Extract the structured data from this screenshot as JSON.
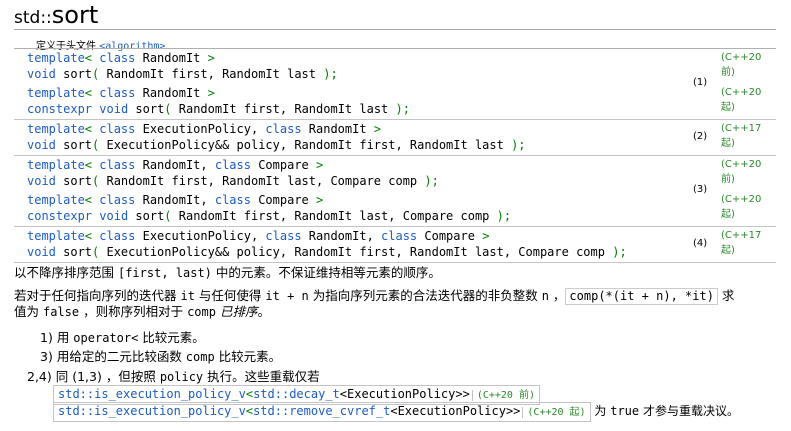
{
  "title": {
    "namespace": "std::",
    "name": "sort"
  },
  "header": {
    "label": "定义于头文件 ",
    "file": "<algorithm>"
  },
  "decls": [
    {
      "num": "(1)",
      "rows": [
        {
          "std": "(C++20 前)",
          "parts": [
            [
              "kw",
              "template"
            ],
            [
              "pn",
              "< "
            ],
            [
              "kw",
              "class"
            ],
            [
              "",
              " RandomIt "
            ],
            [
              "pn",
              ">"
            ],
            [
              "nl",
              ""
            ],
            [
              "kw",
              "void"
            ],
            [
              "",
              " sort"
            ],
            [
              "pn",
              "( "
            ],
            [
              "",
              "RandomIt first, RandomIt last "
            ],
            [
              "pn",
              ");"
            ]
          ]
        },
        {
          "std": "(C++20 起)",
          "parts": [
            [
              "kw",
              "template"
            ],
            [
              "pn",
              "< "
            ],
            [
              "kw",
              "class"
            ],
            [
              "",
              " RandomIt "
            ],
            [
              "pn",
              ">"
            ],
            [
              "nl",
              ""
            ],
            [
              "kw",
              "constexpr"
            ],
            [
              "",
              " "
            ],
            [
              "kw",
              "void"
            ],
            [
              "",
              " sort"
            ],
            [
              "pn",
              "( "
            ],
            [
              "",
              "RandomIt first, RandomIt last "
            ],
            [
              "pn",
              ");"
            ]
          ]
        }
      ]
    },
    {
      "num": "(2)",
      "rows": [
        {
          "std": "(C++17 起)",
          "parts": [
            [
              "kw",
              "template"
            ],
            [
              "pn",
              "< "
            ],
            [
              "kw",
              "class"
            ],
            [
              "",
              " ExecutionPolicy, "
            ],
            [
              "kw",
              "class"
            ],
            [
              "",
              " RandomIt "
            ],
            [
              "pn",
              ">"
            ],
            [
              "nl",
              ""
            ],
            [
              "kw",
              "void"
            ],
            [
              "",
              " sort"
            ],
            [
              "pn",
              "( "
            ],
            [
              "",
              "ExecutionPolicy&& policy, RandomIt first, RandomIt last "
            ],
            [
              "pn",
              ");"
            ]
          ]
        }
      ]
    },
    {
      "num": "(3)",
      "rows": [
        {
          "std": "(C++20 前)",
          "parts": [
            [
              "kw",
              "template"
            ],
            [
              "pn",
              "< "
            ],
            [
              "kw",
              "class"
            ],
            [
              "",
              " RandomIt, "
            ],
            [
              "kw",
              "class"
            ],
            [
              "",
              " Compare "
            ],
            [
              "pn",
              ">"
            ],
            [
              "nl",
              ""
            ],
            [
              "kw",
              "void"
            ],
            [
              "",
              " sort"
            ],
            [
              "pn",
              "( "
            ],
            [
              "",
              "RandomIt first, RandomIt last, Compare comp "
            ],
            [
              "pn",
              ");"
            ]
          ]
        },
        {
          "std": "(C++20 起)",
          "parts": [
            [
              "kw",
              "template"
            ],
            [
              "pn",
              "< "
            ],
            [
              "kw",
              "class"
            ],
            [
              "",
              " RandomIt, "
            ],
            [
              "kw",
              "class"
            ],
            [
              "",
              " Compare "
            ],
            [
              "pn",
              ">"
            ],
            [
              "nl",
              ""
            ],
            [
              "kw",
              "constexpr"
            ],
            [
              "",
              " "
            ],
            [
              "kw",
              "void"
            ],
            [
              "",
              " sort"
            ],
            [
              "pn",
              "( "
            ],
            [
              "",
              "RandomIt first, RandomIt last, Compare comp "
            ],
            [
              "pn",
              ");"
            ]
          ]
        }
      ]
    },
    {
      "num": "(4)",
      "rows": [
        {
          "std": "(C++17 起)",
          "parts": [
            [
              "kw",
              "template"
            ],
            [
              "pn",
              "< "
            ],
            [
              "kw",
              "class"
            ],
            [
              "",
              " ExecutionPolicy, "
            ],
            [
              "kw",
              "class"
            ],
            [
              "",
              " RandomIt, "
            ],
            [
              "kw",
              "class"
            ],
            [
              "",
              " Compare "
            ],
            [
              "pn",
              ">"
            ],
            [
              "nl",
              ""
            ],
            [
              "kw",
              "void"
            ],
            [
              "",
              " sort"
            ],
            [
              "pn",
              "( "
            ],
            [
              "",
              "ExecutionPolicy&& policy, RandomIt first, RandomIt last, Compare comp "
            ],
            [
              "pn",
              ");"
            ]
          ]
        }
      ]
    }
  ],
  "desc": {
    "p1_a": "以不降序排序范围 ",
    "p1_code": "[first, last)",
    "p1_b": " 中的元素。不保证维持相等元素的顺序。",
    "p2_a": "若对于任何指向序列的迭代器 ",
    "p2_it": "it",
    "p2_b": " 与任何使得 ",
    "p2_itn": "it + n",
    "p2_c": " 为指向序列元素的合法迭代器的非负整数 ",
    "p2_n": "n",
    "p2_d": " ，",
    "p2_box": "comp(*(it + n), *it)",
    "p2_e": " 求",
    "p3_a": "值为 ",
    "p3_false": "false",
    "p3_b": " ，则称序列相对于 ",
    "p3_comp": "comp",
    "p3_c": " ",
    "p3_ital": "已排序",
    "p3_d": "。"
  },
  "items": {
    "i1_label": "1)",
    "i1_a": " 用 ",
    "i1_code": "operator<",
    "i1_b": " 比较元素。",
    "i3_label": "3)",
    "i3_a": " 用给定的二元比较函数 ",
    "i3_code": "comp",
    "i3_b": " 比较元素。",
    "i24_label": "2,4)",
    "i24_a": " 同 ",
    "i24_ref": "(1,3)",
    "i24_b": " ，但按照 ",
    "i24_code": "policy",
    "i24_c": " 执行。这些重载仅若",
    "t1_a": "std::is_execution_policy_v",
    "t1_b": "<",
    "t1_c": "std::decay_t",
    "t1_d": "<ExecutionPolicy>>",
    "t1_badge": "(C++20 前)",
    "t2_a": "std::is_execution_policy_v",
    "t2_b": "<",
    "t2_c": "std::remove_cvref_t",
    "t2_d": "<ExecutionPolicy>>",
    "t2_badge": "(C++20 起)",
    "tail_a": " 为 ",
    "tail_true": "true",
    "tail_b": " 才参与重载决议。"
  }
}
